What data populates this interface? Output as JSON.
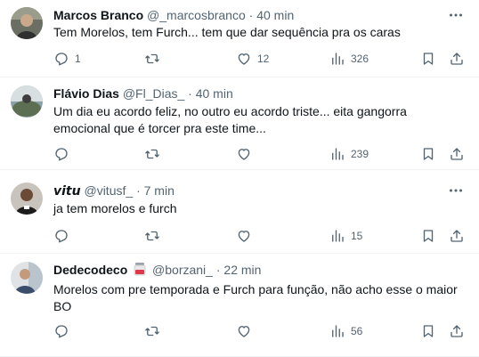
{
  "tweets": [
    {
      "name": "Marcos Branco",
      "name_italic": false,
      "handle": "@_marcosbranco",
      "separator": "·",
      "time": "40 min",
      "text": "Tem Morelos, tem Furch... tem que dar sequência pra os caras",
      "replies": "1",
      "retweets": "",
      "likes": "12",
      "views": "326",
      "avatar_icon": "avatar-photo-icon"
    },
    {
      "name": "Flávio Dias",
      "name_italic": false,
      "handle": "@Fl_Dias_",
      "separator": "·",
      "time": "40 min",
      "text": "Um dia eu acordo feliz, no outro eu acordo triste... eita gangorra emocional que é torcer pra este time...",
      "replies": "",
      "retweets": "",
      "likes": "",
      "views": "239",
      "avatar_icon": "avatar-photo-icon"
    },
    {
      "name": "𝙫𝙞𝙩𝙪",
      "name_italic": true,
      "handle": "@vitusf_",
      "separator": "·",
      "time": "7 min",
      "text": "ja tem morelos e furch",
      "replies": "",
      "retweets": "",
      "likes": "",
      "views": "15",
      "avatar_icon": "avatar-photo-icon"
    },
    {
      "name": "Dedecodeco",
      "name_italic": false,
      "handle": "@borzani_",
      "separator": "·",
      "time": "22 min",
      "text": "Morelos com pre temporada e Furch para função, não acho esse o maior BO",
      "replies": "",
      "retweets": "",
      "likes": "",
      "views": "56",
      "avatar_icon": "avatar-photo-icon",
      "badge_icon": "jar-emoji-icon"
    }
  ],
  "colors": {
    "text": "#0f1419",
    "secondary": "#536471",
    "divider": "#eff3f4",
    "background": "#ffffff"
  }
}
